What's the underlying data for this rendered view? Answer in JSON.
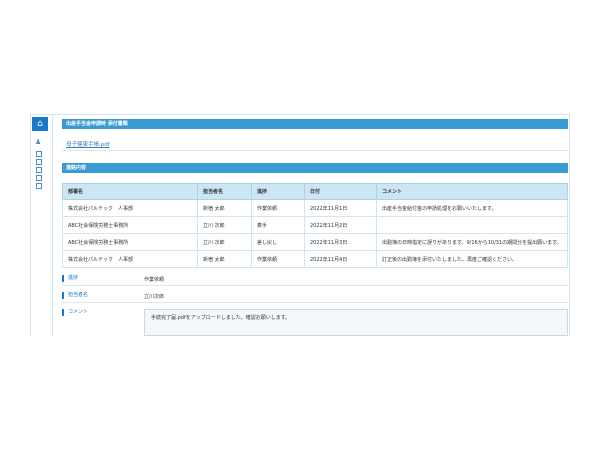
{
  "sidebar": {
    "home_icon": "home-icon",
    "items": [
      "user-group-icon",
      "doc-icon",
      "doc-icon",
      "doc-icon",
      "doc-icon",
      "doc-icon"
    ]
  },
  "attachments": {
    "title": "出産手当金申請時 添付書類",
    "file": "母子健康手帳.pdf"
  },
  "contact": {
    "title": "連絡内容",
    "columns": [
      "部署名",
      "担当者名",
      "進捗",
      "日付",
      "コメント"
    ],
    "rows": [
      [
        "株式会社パルテック　人事部",
        "新宿 太郎",
        "作業依頼",
        "2022年11月1日",
        "出産手当金給付金の申請処理をお願いいたします。"
      ],
      [
        "ABC社会保険労務士事務所",
        "立川 次郎",
        "着手",
        "2022年11月2日",
        ""
      ],
      [
        "ABC社会保険労務士事務所",
        "立川 次郎",
        "差し戻し",
        "2022年11月3日",
        "出勤簿の日時指定に誤りがあります。9/16から10/31の期間分を提出願います。"
      ],
      [
        "株式会社パルテック　人事部",
        "新宿 太郎",
        "作業依頼",
        "2022年11月4日",
        "訂正後の出勤簿を添付いたしました。再度ご確認ください。"
      ]
    ]
  },
  "form": {
    "progress_label": "進捗",
    "progress_value": "作業依頼",
    "person_label": "担当者名",
    "person_value": "立川次郎",
    "comment_label": "コメント",
    "comment_value": "手続完了届.pdfをアップロードしました。確認お願いします。"
  }
}
